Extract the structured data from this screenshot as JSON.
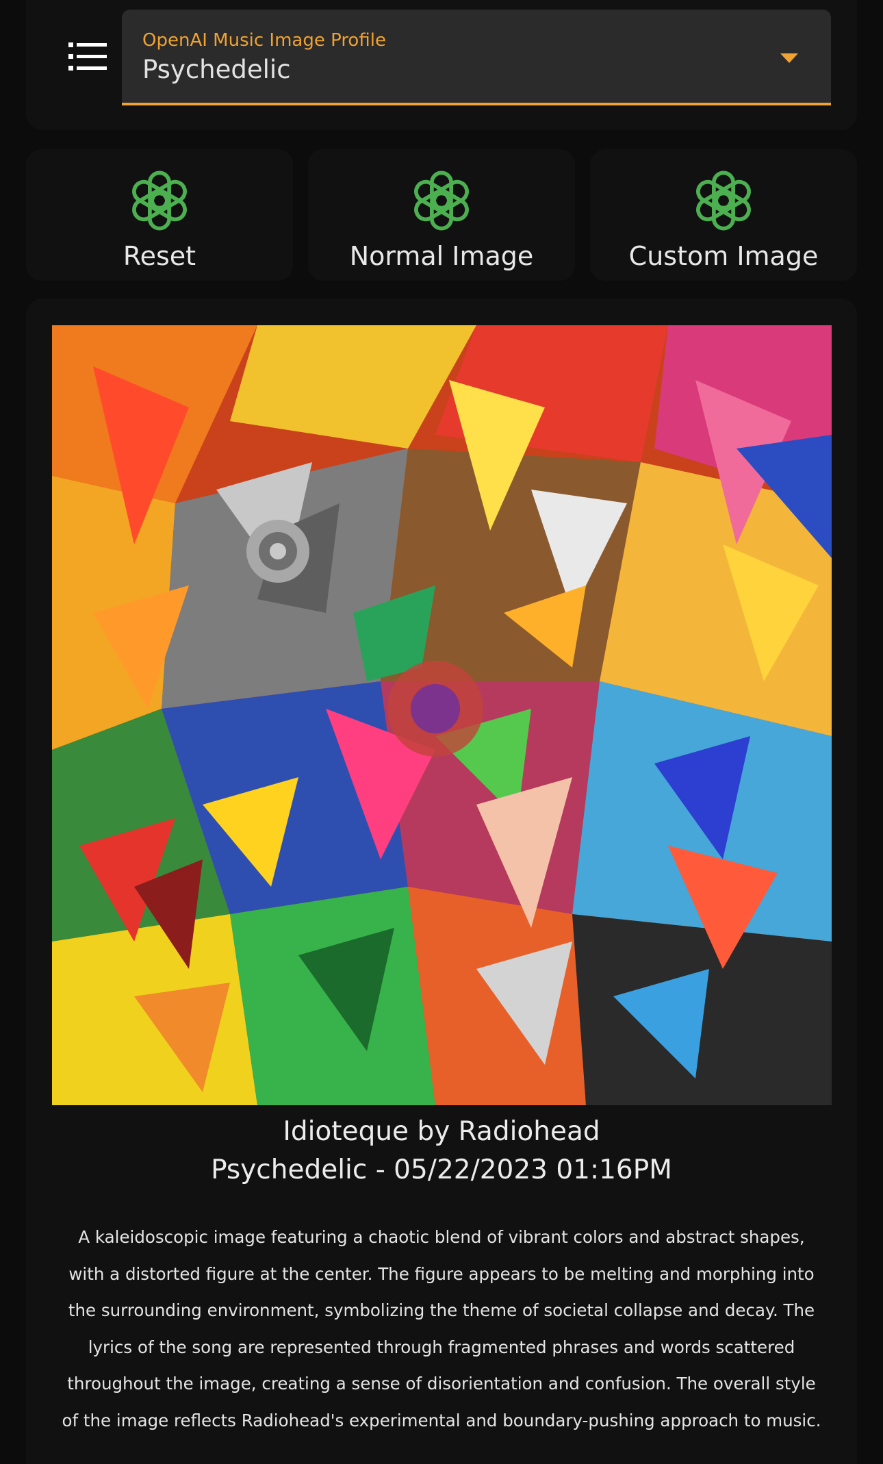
{
  "header": {
    "menu_icon": "list-icon",
    "profile_select": {
      "label": "OpenAI Music Image Profile",
      "value": "Psychedelic",
      "accent_color": "#f0a233"
    }
  },
  "actions": [
    {
      "label": "Reset",
      "icon": "openai-logo-icon"
    },
    {
      "label": "Normal Image",
      "icon": "openai-logo-icon"
    },
    {
      "label": "Custom Image",
      "icon": "openai-logo-icon"
    }
  ],
  "colors": {
    "background": "#0c0c0c",
    "card": "#111111",
    "accent": "#f0a233",
    "icon_green": "#4caf50"
  },
  "main": {
    "image_alt": "psychedelic-artwork",
    "title": "Idioteque by Radiohead",
    "meta": "Psychedelic - 05/22/2023 01:16PM",
    "description": "A kaleidoscopic image featuring a chaotic blend of vibrant colors and abstract shapes, with a distorted figure at the center. The figure appears to be melting and morphing into the surrounding environment, symbolizing the theme of societal collapse and decay. The lyrics of the song are represented through fragmented phrases and words scattered throughout the image, creating a sense of disorientation and confusion. The overall style of the image reflects Radiohead's experimental and boundary-pushing approach to music."
  }
}
